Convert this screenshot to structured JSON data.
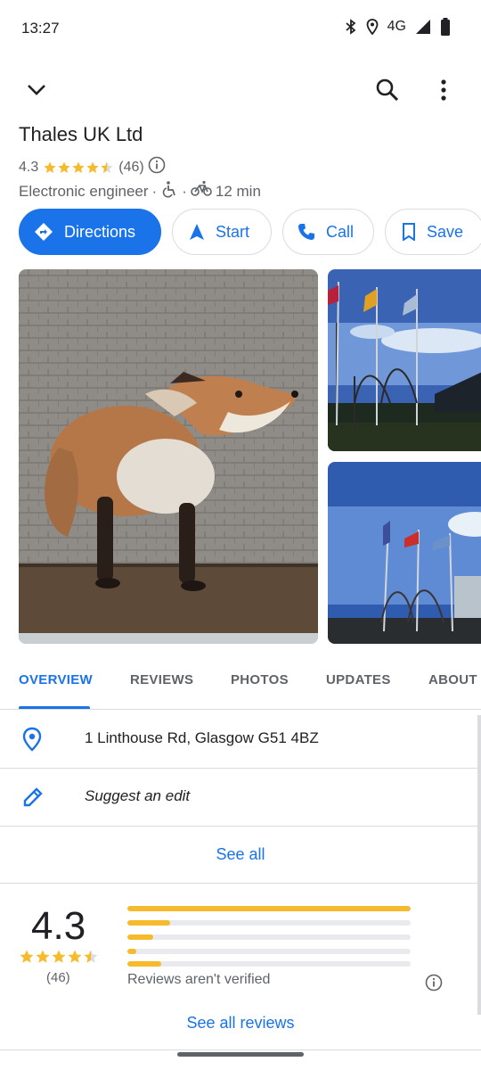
{
  "status_bar": {
    "time": "13:27",
    "network": "4G"
  },
  "place": {
    "title": "Thales UK Ltd",
    "rating": "4.3",
    "review_count": "(46)",
    "category": "Electronic engineer",
    "separator": "·",
    "travel_time": "12 min"
  },
  "actions": {
    "directions": "Directions",
    "start": "Start",
    "call": "Call",
    "save": "Save"
  },
  "tabs": {
    "overview": "OVERVIEW",
    "reviews": "REVIEWS",
    "photos": "PHOTOS",
    "updates": "UPDATES",
    "about": "ABOUT"
  },
  "overview": {
    "address": "1 Linthouse Rd, Glasgow G51 4BZ",
    "suggest_edit": "Suggest an edit",
    "see_all": "See all"
  },
  "review_summary": {
    "rating": "4.3",
    "count": "(46)",
    "not_verified": "Reviews aren't verified",
    "see_all_reviews": "See all reviews",
    "distribution_fractions": [
      1.0,
      0.15,
      0.09,
      0.03,
      0.12
    ]
  },
  "colors": {
    "accent": "#1a73e8",
    "star": "#f6bb2c",
    "text_secondary": "#5f6368"
  },
  "icons": [
    "chevron-down-icon",
    "search-icon",
    "more-vert-icon",
    "bluetooth-icon",
    "location-icon",
    "signal-icon",
    "battery-icon",
    "wheelchair-icon",
    "bicycle-icon",
    "directions-icon",
    "navigation-icon",
    "phone-icon",
    "bookmark-icon",
    "pin-icon",
    "pencil-icon",
    "info-icon"
  ]
}
